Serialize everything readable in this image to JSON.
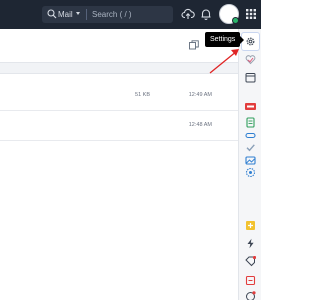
{
  "topbar": {
    "search": {
      "scope_label": "Mail",
      "placeholder": "Search ( / )"
    },
    "icons": [
      "cloud-upload-icon",
      "bell-icon",
      "avatar",
      "apps-grid-icon"
    ]
  },
  "tooltip": {
    "label": "Settings"
  },
  "messages": [
    {
      "size": "51 KB",
      "time": "12:49 AM"
    },
    {
      "size": "",
      "time": "12:48 AM"
    }
  ],
  "rail": {
    "top_icons": [
      "settings-icon",
      "heart-icon",
      "calendar-icon"
    ],
    "mid_icons": [
      "new-badge-icon",
      "notes-icon",
      "link-icon",
      "check-icon",
      "mail-icon",
      "contacts-icon"
    ],
    "bottom_icons": [
      "add-note-icon",
      "lightning-icon",
      "tag-icon",
      "alarm-icon",
      "clock-icon"
    ]
  },
  "colors": {
    "topbar_bg": "#1e2633",
    "accent_arrow": "#e02424",
    "status_online": "#2ab56b",
    "rail_bg": "#f5f6f8"
  }
}
